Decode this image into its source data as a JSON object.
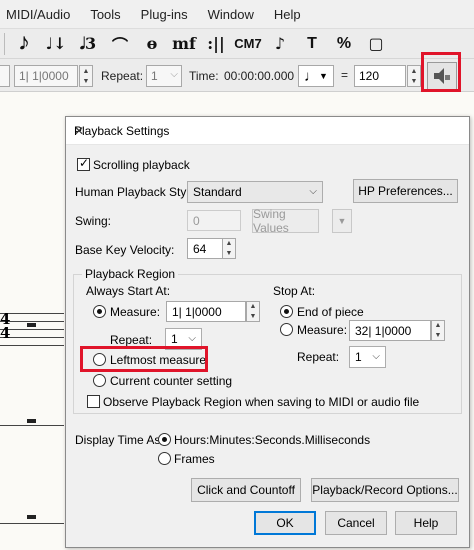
{
  "menu": [
    "MIDI/Audio",
    "Tools",
    "Plug-ins",
    "Window",
    "Help"
  ],
  "toolbar_glyphs": [
    "𝅘𝅥𝅮",
    "♩↓",
    "𝅘𝅥3",
    "⌒",
    "ɵ",
    "mf",
    ":||",
    "CM7",
    "♪",
    "T",
    "%",
    "▢"
  ],
  "transport": {
    "counter": "1| 1|0000",
    "repeat_label": "Repeat:",
    "repeat_value": "1",
    "time_label": "Time:",
    "time_value": "00:00:00.000",
    "equals": "=",
    "tempo": "120"
  },
  "dialog": {
    "title": "Playback Settings",
    "close": "✕",
    "scrolling_playback": "Scrolling playback",
    "human_style_label": "Human Playback Style:",
    "human_style_value": "Standard",
    "hp_prefs_button": "HP Preferences...",
    "swing_label": "Swing:",
    "swing_value": "0",
    "swing_values_button": "Swing Values",
    "base_key_label": "Base Key Velocity:",
    "base_key_value": "64",
    "region_label": "Playback Region",
    "always_start_label": "Always Start At:",
    "measure_label": "Measure:",
    "start_measure_value": "1| 1|0000",
    "repeat_label": "Repeat:",
    "start_repeat_value": "1",
    "leftmost_measure": "Leftmost measure",
    "current_counter": "Current counter setting",
    "stop_at_label": "Stop At:",
    "end_of_piece": "End of piece",
    "stop_measure_label": "Measure:",
    "stop_measure_value": "32| 1|0000",
    "stop_repeat_label": "Repeat:",
    "stop_repeat_value": "1",
    "observe_region": "Observe Playback Region when saving to MIDI or audio file",
    "display_time_label": "Display Time As:",
    "display_hms": "Hours:Minutes:Seconds.Milliseconds",
    "display_frames": "Frames",
    "click_countoff_button": "Click and Countoff",
    "playback_record_button": "Playback/Record Options...",
    "ok_button": "OK",
    "cancel_button": "Cancel",
    "help_button": "Help"
  },
  "colors": {
    "highlight": "#e0142a",
    "focus": "#0078d7"
  }
}
